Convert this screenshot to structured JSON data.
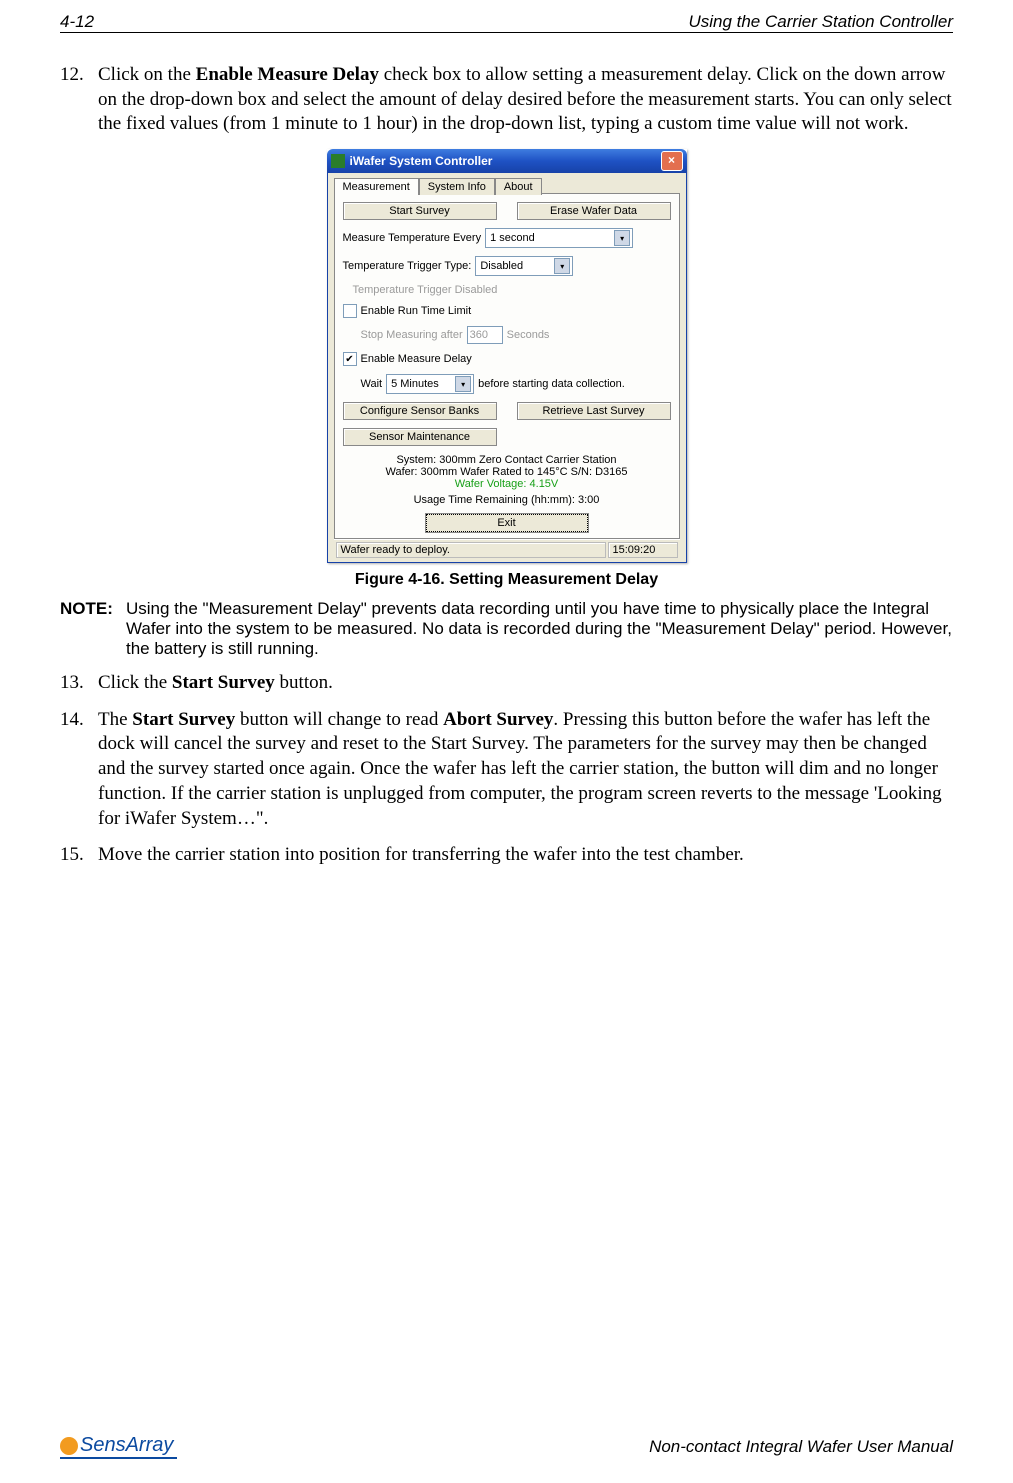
{
  "header": {
    "page_num": "4-12",
    "section": "Using the Carrier Station Controller"
  },
  "para12": {
    "num": "12.",
    "pre": "Click on the ",
    "b1": "Enable Measure Delay",
    "post": " check box to allow setting a measurement delay. Click on the down arrow on the drop-down box and select the amount of delay desired before the measurement starts. You can only select the fixed values (from 1 minute to 1 hour) in the drop-down list, typing a custom time value will not work."
  },
  "app": {
    "title": "iWafer System Controller",
    "tabs": {
      "t1": "Measurement",
      "t2": "System Info",
      "t3": "About"
    },
    "start_survey": "Start Survey",
    "erase_wafer": "Erase Wafer Data",
    "mte_label": "Measure Temperature Every",
    "mte_value": "1 second",
    "ttt_label": "Temperature Trigger Type:",
    "ttt_value": "Disabled",
    "ttt_disabled": "Temperature Trigger Disabled",
    "runtime_chk": "Enable Run Time Limit",
    "stop_after_pre": "Stop Measuring after",
    "stop_after_val": "360",
    "stop_after_post": "Seconds",
    "delay_chk": "Enable Measure Delay",
    "wait_label": "Wait",
    "wait_value": "5 Minutes",
    "wait_post": "before starting data collection.",
    "cfg_banks": "Configure Sensor Banks",
    "retr_last": "Retrieve Last Survey",
    "sensor_maint": "Sensor Maintenance",
    "sys_line": "System: 300mm Zero Contact Carrier Station",
    "wafer_line": "Wafer: 300mm Wafer Rated to 145°C S/N: D3165",
    "voltage": "Wafer Voltage: 4.15V",
    "usage": "Usage Time Remaining (hh:mm): 3:00",
    "exit": "Exit",
    "status": "Wafer ready to deploy.",
    "clock": "15:09:20"
  },
  "figcaption": "Figure 4-16. Setting Measurement Delay",
  "note": {
    "label": "NOTE:",
    "text": "Using the \"Measurement Delay\" prevents data recording until you have time to physically place the Integral Wafer into the system to be measured. No data is recorded during the \"Measurement Delay\" period. However, the battery is still running."
  },
  "para13": {
    "num": "13.",
    "pre": "Click the ",
    "b1": "Start Survey",
    "post": " button."
  },
  "para14": {
    "num": "14.",
    "pre": "The ",
    "b1": "Start Survey",
    "mid1": " button will change to read ",
    "b2": "Abort Survey",
    "post": ". Pressing this button before the wafer has left the dock will cancel the survey and reset to the Start Survey. The parameters for the survey may then be changed and the survey started once again. Once the wafer has left the carrier station, the button will dim and no longer function. If the carrier station is unplugged from computer, the program screen reverts to the message 'Looking for iWafer System…\"."
  },
  "para15": {
    "num": "15.",
    "text": "Move the carrier station into position for transferring the wafer into the test chamber."
  },
  "footer": {
    "logo": "SensArray",
    "right": "Non-contact Integral Wafer User Manual"
  }
}
